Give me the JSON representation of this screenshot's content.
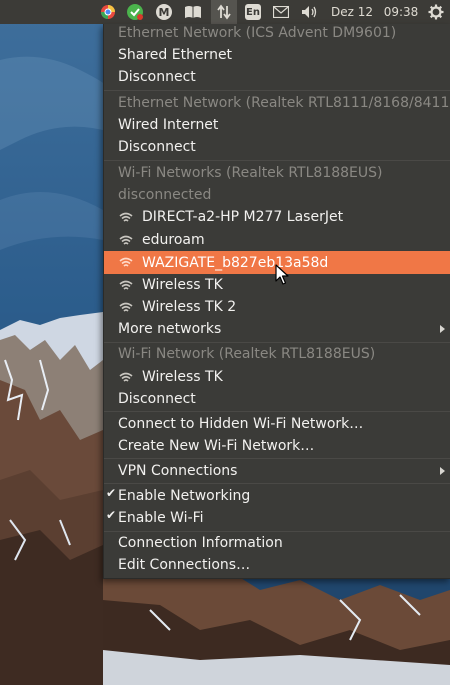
{
  "panel": {
    "icons": [
      "chrome-icon",
      "check-update-icon",
      "m-icon",
      "book-icon",
      "network-arrows-icon",
      "keyboard-layout-icon",
      "mail-icon",
      "volume-icon",
      "power-gear-icon"
    ],
    "keyboard_layout": "En",
    "date": "Dez 12",
    "time": "09:38"
  },
  "menu": {
    "eth1_header": "Ethernet Network (ICS Advent DM9601)",
    "eth1_conn": "Shared Ethernet",
    "eth1_disconnect": "Disconnect",
    "eth2_header": "Ethernet Network (Realtek RTL8111/8168/8411)",
    "eth2_conn": "Wired Internet",
    "eth2_disconnect": "Disconnect",
    "wifi1_header": "Wi-Fi Networks (Realtek RTL8188EUS)",
    "wifi1_status": "disconnected",
    "wifi1_networks": [
      "DIRECT-a2-HP M277 LaserJet",
      "eduroam",
      "WAZIGATE_b827eb13a58d",
      "Wireless TK",
      "Wireless TK 2"
    ],
    "more_networks": "More networks",
    "wifi2_header": "Wi-Fi Network (Realtek RTL8188EUS)",
    "wifi2_conn": "Wireless TK",
    "wifi2_disconnect": "Disconnect",
    "hidden_network": "Connect to Hidden Wi-Fi Network…",
    "new_network": "Create New Wi-Fi Network…",
    "vpn": "VPN Connections",
    "enable_networking": "Enable Networking",
    "enable_wifi": "Enable Wi-Fi",
    "connection_info": "Connection Information",
    "edit_connections": "Edit Connections…"
  },
  "colors": {
    "highlight": "#f07746",
    "panel_bg": "#3c3b37",
    "menu_bg": "#3b3b38",
    "header_text": "#8a8883"
  }
}
